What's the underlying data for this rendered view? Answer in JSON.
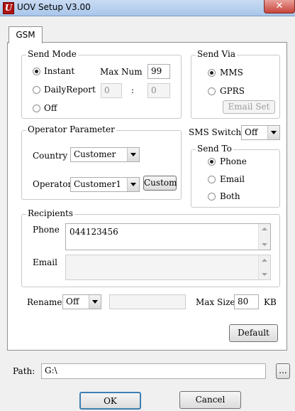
{
  "window": {
    "title": "UOV Setup V3.00",
    "close_label": "✕",
    "icon": "app-logo-icon"
  },
  "tabs": [
    {
      "label": "GSM",
      "active": true
    }
  ],
  "send_mode": {
    "title": "Send Mode",
    "instant_label": "Instant",
    "daily_label": "DailyReport",
    "off_label": "Off",
    "selected": "Instant",
    "max_num_label": "Max Num",
    "max_num_value": "99",
    "hour_value": "0",
    "time_sep": ":",
    "minute_value": "0"
  },
  "send_via": {
    "title": "Send Via",
    "mms_label": "MMS",
    "gprs_label": "GPRS",
    "selected": "MMS",
    "email_set_label": "Email Set"
  },
  "operator": {
    "title": "Operator Parameter",
    "country_label": "Country",
    "country_value": "Customer",
    "operator_label": "Operator",
    "operator_value": "Customer1",
    "custom_label": "Custom"
  },
  "sms_switch": {
    "label": "SMS Switch",
    "value": "Off"
  },
  "send_to": {
    "title": "Send To",
    "phone_label": "Phone",
    "email_label": "Email",
    "both_label": "Both",
    "selected": "Phone"
  },
  "recipients": {
    "title": "Recipients",
    "phone_label": "Phone",
    "phone_value": "044123456",
    "email_label": "Email",
    "email_value": ""
  },
  "rename": {
    "label": "Rename",
    "value": "Off",
    "text_value": ""
  },
  "max_size": {
    "label": "Max Size",
    "value": "80",
    "unit": "KB"
  },
  "default_label": "Default",
  "path": {
    "label": "Path:",
    "value": "G:\\",
    "browse_label": "..."
  },
  "footer": {
    "ok_label": "OK",
    "cancel_label": "Cancel"
  }
}
